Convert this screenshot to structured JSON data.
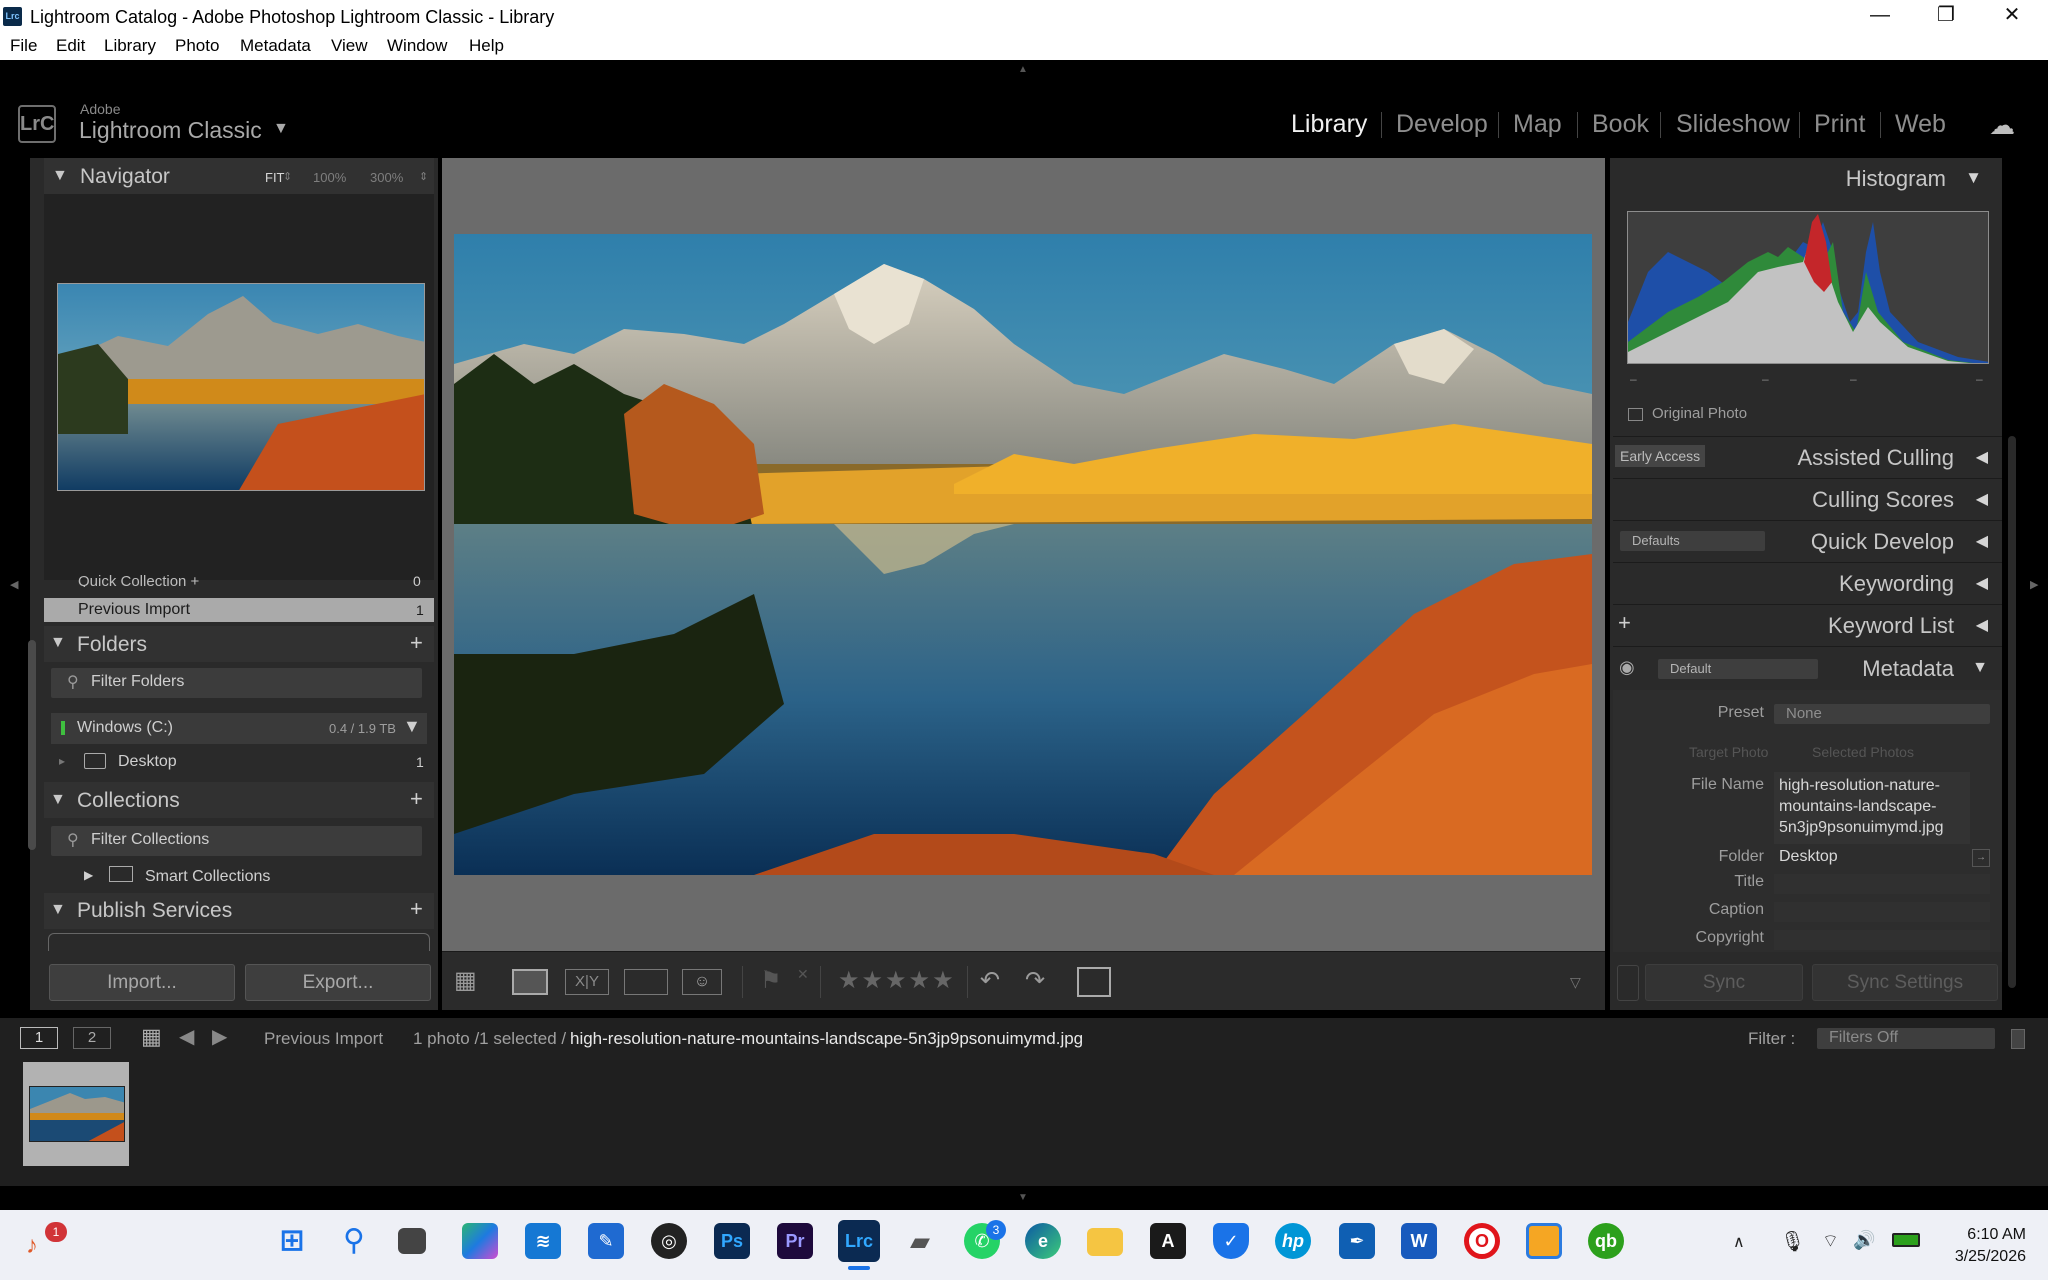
{
  "window": {
    "title": "Lightroom Catalog - Adobe Photoshop Lightroom Classic - Library",
    "app_icon": "Lrc",
    "controls": {
      "minimize": "—",
      "restore": "❐",
      "close": "✕"
    }
  },
  "menu": [
    "File",
    "Edit",
    "Library",
    "Photo",
    "Metadata",
    "View",
    "Window",
    "Help"
  ],
  "identity": {
    "badge": "LrC",
    "brand": "Adobe",
    "product": "Lightroom Classic",
    "arrow": "▼"
  },
  "modules": [
    "Library",
    "Develop",
    "Map",
    "Book",
    "Slideshow",
    "Print",
    "Web"
  ],
  "active_module": "Library",
  "left": {
    "navigator": {
      "title": "Navigator",
      "zoom": [
        "FIT",
        "100%",
        "300%"
      ]
    },
    "catalog": {
      "quick_collection": "Quick Collection  +",
      "quick_collection_count": "0",
      "previous_import": "Previous Import",
      "previous_import_count": "1"
    },
    "folders": {
      "title": "Folders",
      "filter": "Filter Folders",
      "volume": "Windows (C:)",
      "volume_size": "0.4 / 1.9 TB",
      "folder": "Desktop",
      "folder_count": "1"
    },
    "collections": {
      "title": "Collections",
      "filter": "Filter Collections",
      "smart": "Smart Collections"
    },
    "publish": {
      "title": "Publish Services"
    },
    "import_label": "Import...",
    "export_label": "Export..."
  },
  "right": {
    "histogram": {
      "title": "Histogram",
      "original_photo": "Original Photo",
      "dashes": [
        "–",
        "–",
        "–",
        "–"
      ]
    },
    "early_access": "Early Access",
    "panels": [
      "Assisted Culling",
      "Culling Scores",
      "Quick Develop",
      "Keywording",
      "Keyword List",
      "Metadata"
    ],
    "quick_develop_preset": "Defaults",
    "metadata_preset_selector": "Default",
    "metadata": {
      "preset_label": "Preset",
      "preset_value": "None",
      "target_photo": "Target Photo",
      "selected_photos": "Selected Photos",
      "file_name_label": "File Name",
      "file_name_lines": [
        "high-resolution-nature-",
        "mountains-landscape-",
        "5n3jp9psonuimymd.jpg"
      ],
      "folder_label": "Folder",
      "folder_value": "Desktop",
      "title_label": "Title",
      "caption_label": "Caption",
      "copyright_label": "Copyright"
    },
    "sync": "Sync",
    "sync_settings": "Sync Settings"
  },
  "filmbar": {
    "monitor1": "1",
    "monitor2": "2",
    "source": "Previous Import",
    "count": "1 photo /1 selected /",
    "filename": "high-resolution-nature-mountains-landscape-5n3jp9psonuimymd.jpg",
    "filter_label": "Filter :",
    "filter_value": "Filters Off"
  },
  "taskbar": {
    "notif_badge": "1",
    "whatsapp_badge": "3",
    "time": "6:10 AM",
    "date": "3/25/2026"
  },
  "colors": {
    "lr_bg": "#2a2a2a",
    "center_bg": "#6b6b6b",
    "taskbar_bg": "#eef0f6"
  }
}
